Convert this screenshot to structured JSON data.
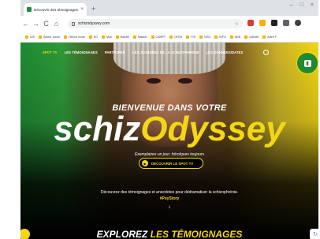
{
  "browser": {
    "tab_title": "Découvrir des témoignages",
    "tab_close": "×",
    "new_tab": "+",
    "window_controls": [
      "–",
      "□",
      "×"
    ],
    "nav": {
      "back": "←",
      "forward": "→",
      "reload": "C",
      "home": "⌂"
    },
    "url": "schizodyssey.com",
    "star": "☆",
    "bookmarks": [
      "IUE",
      "Auteur Junior",
      "Retour Invite",
      "EO",
      "Mail",
      "Handle",
      "Maison",
      "CAMPT",
      "OFDR",
      "FHI",
      "NGO",
      "INFO",
      "AEB",
      "collectif",
      "Autre F"
    ]
  },
  "site": {
    "nav_items": [
      "SPOT TV",
      "LES TÉMOIGNAGES",
      "PARTICIPER",
      "LES JOURNÉES DE LA SCHIZOPHRÉNIE",
      "LES DONNÉES/DATES"
    ],
    "badge_text": "SCHIZ ODYSSEY",
    "welcome": "BIENVENUE DANS VOTRE",
    "logo_part1": "schiz",
    "logo_part2": "Odyssey",
    "tagline": "Exemplaires un jour, héroïques toujours",
    "cta_label": "DÉCOUVRIR LE SPOT TV",
    "description": "Découvrez des témoignages et anecdotes pour dédramatiser la schizophrénie.",
    "hashtag": "#PsyStory",
    "scroll_arrow": "↓",
    "explore_white": "EXPLOREZ",
    "explore_yellow": "LES TÉMOIGNAGES"
  },
  "colors": {
    "brand_green": "#1f8a32",
    "brand_yellow": "#f2d713"
  }
}
